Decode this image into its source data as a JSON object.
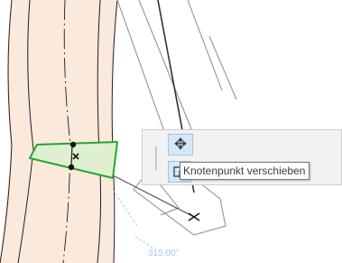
{
  "canvas": {
    "wall_fill_color": "#fbe9dc",
    "selection_color": "#22a832",
    "selection_fill_color": "#dff0d0",
    "guide_color": "#a9c8ee",
    "angle_readout": "315.00°"
  },
  "pet_palette": {
    "tools": [
      {
        "name": "move-node",
        "icon": "move-arrows-icon",
        "glyph": "✥",
        "state": "active"
      },
      {
        "name": "offset-edge",
        "icon": "offset-edge-icon",
        "glyph": "",
        "state": "partially-hidden"
      },
      {
        "name": "curve-edge",
        "icon": "curve-edge-icon",
        "glyph": "↷",
        "state": "partially-hidden"
      },
      {
        "name": "insert-node",
        "icon": "insert-node-icon",
        "glyph": "",
        "state": "partially-hidden"
      },
      {
        "name": "stretch",
        "icon": "stretch-icon",
        "glyph": "",
        "state": "partially-hidden"
      },
      {
        "name": "more",
        "icon": "more-tools-icon",
        "glyph": "",
        "state": "partially-hidden"
      }
    ]
  },
  "tooltip": {
    "text": "Knotenpunkt verschieben"
  }
}
